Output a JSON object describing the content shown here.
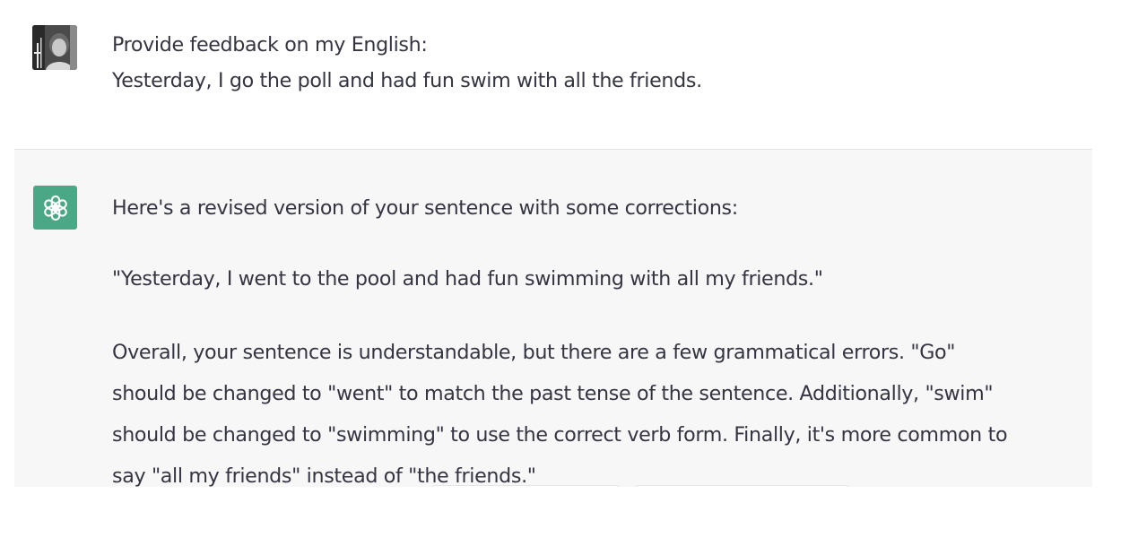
{
  "conversation": {
    "user_message": {
      "avatar": "user-photo-avatar",
      "lines": [
        "Provide feedback on my English:",
        "Yesterday, I go the poll and had fun swim with all the friends."
      ]
    },
    "assistant_message": {
      "avatar": "openai-logo-icon",
      "avatar_color": "#4aa886",
      "intro": "Here's a revised version of your sentence with some corrections:",
      "revised": "\"Yesterday, I went to the pool and had fun swimming with all my friends.\"",
      "explanation_lines": [
        "Overall, your sentence is understandable, but there are a few grammatical errors. \"Go\"",
        "should be changed to \"went\" to match the past tense of the sentence. Additionally, \"swim\"",
        "should be changed to \"swimming\" to use the correct verb form. Finally, it's more common to",
        "say \"all my friends\" instead of \"the friends.\""
      ]
    }
  },
  "colors": {
    "text": "#343541",
    "assistant_bg": "#f7f7f8",
    "divider": "#e3e3e6"
  }
}
